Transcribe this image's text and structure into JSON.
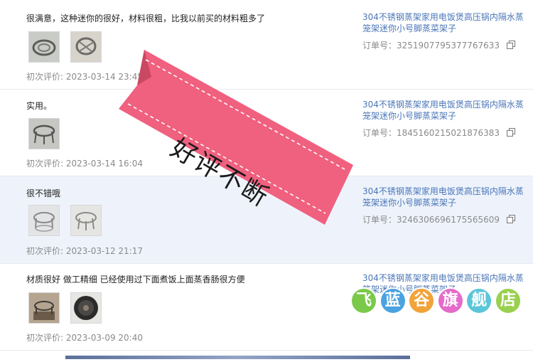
{
  "reviews": [
    {
      "comment": "很满意，这种迷你的很好，材料很粗，比我以前买的材料粗多了",
      "date_label": "初次评价: 2023-03-14 23:45",
      "product": "304不锈钢蒸架家用电饭煲高压锅内隔水蒸笼架迷你小号脚蒸菜架子",
      "order_label": "订单号：3251907795377767633",
      "photo_count": 2
    },
    {
      "comment": "实用。",
      "date_label": "初次评价: 2023-03-14 16:04",
      "product": "304不锈钢蒸架家用电饭煲高压锅内隔水蒸笼架迷你小号脚蒸菜架子",
      "order_label": "订单号：1845160215021876383",
      "photo_count": 1
    },
    {
      "comment": "很不错哦",
      "date_label": "初次评价: 2023-03-12 21:17",
      "product": "304不锈钢蒸架家用电饭煲高压锅内隔水蒸笼架迷你小号脚蒸菜架子",
      "order_label": "订单号：3246306696175565609",
      "photo_count": 2
    },
    {
      "comment": "材质很好 做工精细 已经使用过下面煮饭上面蒸香肠很方便",
      "date_label": "初次评价: 2023-03-09 20:40",
      "product": "304不锈钢蒸架家用电饭煲高压锅内隔水蒸笼架迷你小号脚蒸菜架子",
      "order_label": "",
      "photo_count": 2
    }
  ],
  "ribbon": {
    "text": "好评不断",
    "color": "#f0607f"
  },
  "watermark": {
    "chars": [
      "飞",
      "蓝",
      "谷",
      "旗",
      "舰",
      "店"
    ],
    "colors": [
      "#7bc94b",
      "#4aa3e0",
      "#f2a33a",
      "#e56ac9",
      "#5bc6d9",
      "#9ad04f"
    ]
  },
  "colors": {
    "link": "#4a76b8",
    "highlight_row": "#eef3fb"
  },
  "icons": [
    "copy-icon"
  ]
}
